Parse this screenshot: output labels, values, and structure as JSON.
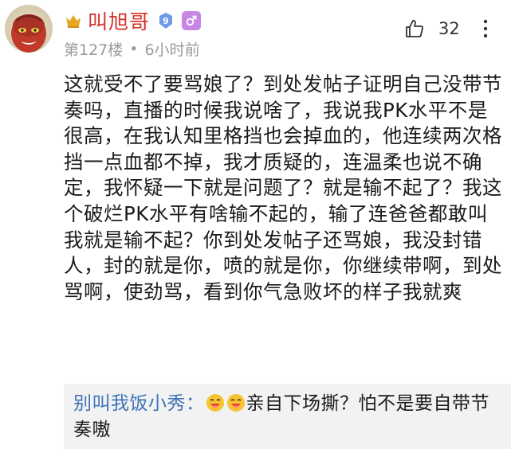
{
  "post": {
    "username": "叫旭哥",
    "floor": "第127楼",
    "separator": "•",
    "time": "6小时前",
    "level": "9",
    "gender_symbol": "♂",
    "likes": "32",
    "content": "这就受不了要骂娘了？到处发帖子证明自己没带节奏吗，直播的时候我说啥了，我说我PK水平不是很高，在我认知里格挡也会掉血的，他连续两次格挡一点血都不掉，我才质疑的，连温柔也说不确定，我怀疑一下就是问题了？就是输不起了？我这个破烂PK水平有啥输不起的，输了连爸爸都敢叫我就是输不起？你到处发帖子还骂娘，我没封错人，封的就是你，喷的就是你，你继续带啊，到处骂啊，使劲骂，看到你气急败坏的样子我就爽"
  },
  "reply": {
    "author": "别叫我饭小秀：",
    "text": "亲自下场撕？怕不是要自带节奏嗷"
  },
  "colors": {
    "username": "#d4332a",
    "reply_author": "#3e73b8",
    "meta": "#9a9a9a",
    "quote_bg": "#f2f2f2",
    "gender_badge": "#c787e6"
  },
  "icons": {
    "crown": "crown-icon",
    "level": "level-badge-icon",
    "gender": "male-gender-icon",
    "like": "thumbs-up-icon",
    "more": "more-options-icon",
    "emoji": "grinning-face-emoji"
  }
}
